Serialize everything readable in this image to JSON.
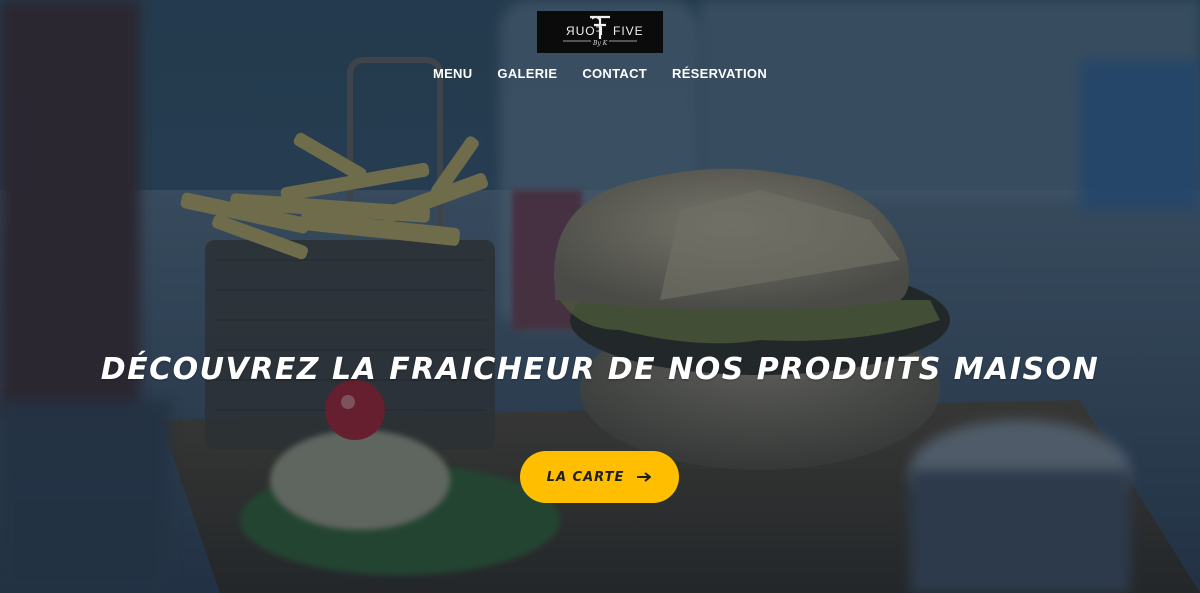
{
  "logo": {
    "left_word": "FOUR",
    "right_word": "FIVE",
    "signature": "By K"
  },
  "nav": {
    "items": [
      {
        "label": "MENU"
      },
      {
        "label": "GALERIE"
      },
      {
        "label": "CONTACT"
      },
      {
        "label": "RÉSERVATION"
      }
    ]
  },
  "hero": {
    "headline": "DÉCOUVREZ LA FRAICHEUR DE NOS PRODUITS MAISON",
    "cta_label": "LA CARTE",
    "cta_icon": "arrow-right-icon"
  },
  "colors": {
    "accent": "#ffbf00",
    "overlay": "#122238",
    "logo_bg": "#0b0b0b",
    "text": "#ffffff"
  }
}
